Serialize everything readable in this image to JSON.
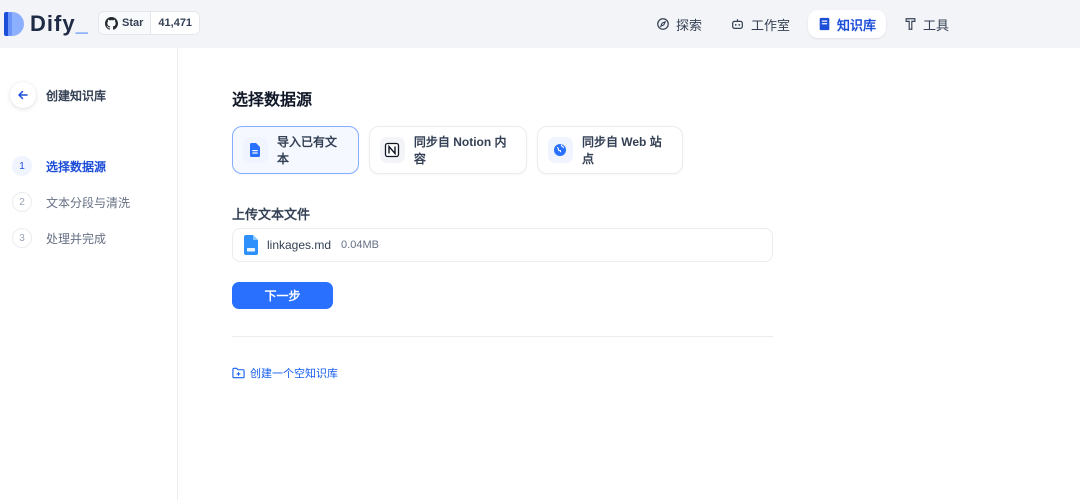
{
  "header": {
    "brand": "Dify",
    "github": {
      "star_label": "Star",
      "star_count": "41,471"
    },
    "nav": [
      {
        "label": "探索",
        "icon": "explore-icon",
        "active": false
      },
      {
        "label": "工作室",
        "icon": "robot-icon",
        "active": false
      },
      {
        "label": "知识库",
        "icon": "book-icon",
        "active": true
      },
      {
        "label": "工具",
        "icon": "tools-icon",
        "active": false
      }
    ]
  },
  "sidebar": {
    "title": "创建知识库",
    "steps": [
      {
        "num": "1",
        "label": "选择数据源",
        "active": true
      },
      {
        "num": "2",
        "label": "文本分段与清洗",
        "active": false
      },
      {
        "num": "3",
        "label": "处理并完成",
        "active": false
      }
    ]
  },
  "main": {
    "title": "选择数据源",
    "sources": [
      {
        "label": "导入已有文本",
        "icon": "document-icon",
        "active": true
      },
      {
        "label": "同步自 Notion 内容",
        "icon": "notion-icon",
        "active": false
      },
      {
        "label": "同步自 Web 站点",
        "icon": "globe-icon",
        "active": false
      }
    ],
    "upload_title": "上传文本文件",
    "file": {
      "name": "linkages.md",
      "size": "0.04MB"
    },
    "next_label": "下一步",
    "create_empty_label": "创建一个空知识库"
  },
  "colors": {
    "accent": "#2970ff",
    "active_text": "#1d4ed8"
  }
}
